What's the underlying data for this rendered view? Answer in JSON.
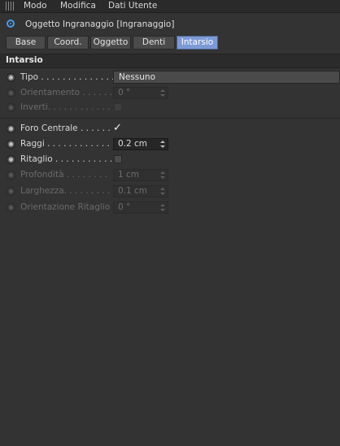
{
  "menubar": {
    "items": [
      {
        "label": "Modo"
      },
      {
        "label": "Modifica"
      },
      {
        "label": "Dati Utente"
      }
    ]
  },
  "title": "Oggetto Ingranaggio [Ingranaggio]",
  "tabs": [
    {
      "label": "Base",
      "active": false
    },
    {
      "label": "Coord.",
      "active": false
    },
    {
      "label": "Oggetto",
      "active": false
    },
    {
      "label": "Denti",
      "active": false
    },
    {
      "label": "Intarsio",
      "active": true
    }
  ],
  "section": {
    "title": "Intarsio"
  },
  "fields": {
    "tipo": {
      "label": "Tipo . . . . . . . . . . . . . .",
      "value": "Nessuno",
      "enabled": true
    },
    "orientamento": {
      "label": "Orientamento . . . . . .",
      "value": "0 °",
      "enabled": false
    },
    "inverti": {
      "label": "Inverti. . . . . . . . . . . .",
      "checked": false,
      "enabled": false
    },
    "foro_centrale": {
      "label": "Foro Centrale . . . . . .",
      "checked": true,
      "check_glyph": "✓",
      "enabled": true
    },
    "raggi": {
      "label": "Raggi . . . . . . . . . . . . .",
      "value": "0.2 cm",
      "enabled": true
    },
    "ritaglio": {
      "label": "Ritaglio . . . . . . . . . . .",
      "checked": false,
      "enabled": true
    },
    "profondita": {
      "label": "Profondità . . . . . . . .",
      "value": "1 cm",
      "enabled": false
    },
    "larghezza": {
      "label": "Larghezza. . . . . . . . . .",
      "value": "0.1 cm",
      "enabled": false
    },
    "orientazione_ritaglio": {
      "label": "Orientazione Ritaglio",
      "value": "0 °",
      "enabled": false
    }
  },
  "colors": {
    "background": "#333333",
    "active_tab": "#7d9ad6",
    "object_icon": "#4a9be8"
  },
  "icons": {
    "grip": "grip-icon",
    "object": "gear-object-icon"
  }
}
